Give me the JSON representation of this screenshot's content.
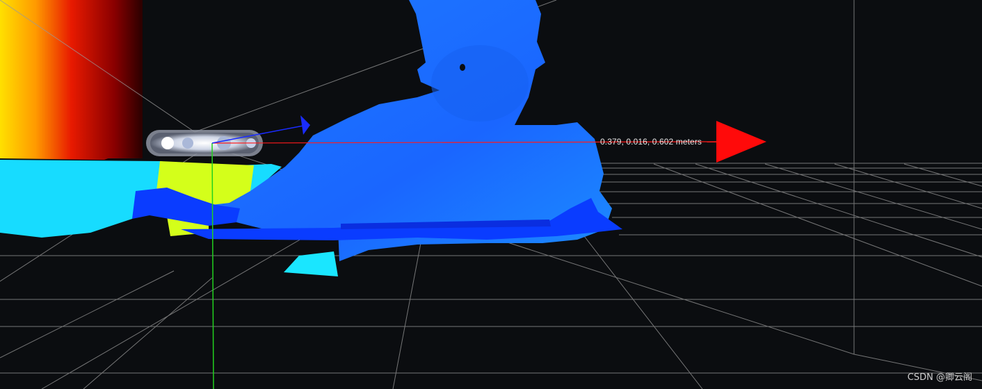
{
  "viewer": {
    "measurement_text": "0.379, 0.016, 0.602 meters",
    "watermark": "CSDN @卿云阁"
  },
  "colors": {
    "background": "#0b0d10",
    "grid_line": "#9a9a9a",
    "x_axis": "#ff1a1a",
    "y_axis": "#22d11e",
    "z_axis": "#1a2cff",
    "person_depth": "#1f74ff",
    "near_depth": "#0a3cff",
    "mid_depth": "#16d8ff",
    "object_depth": "#d8ff1a",
    "far_depth_hot": "#ffd400",
    "far_depth_cold": "#6a0000"
  },
  "icons": {
    "camera": "realsense-camera-icon",
    "x_arrow": "x-axis-arrow-icon",
    "z_arrow": "z-axis-arrow-icon"
  }
}
